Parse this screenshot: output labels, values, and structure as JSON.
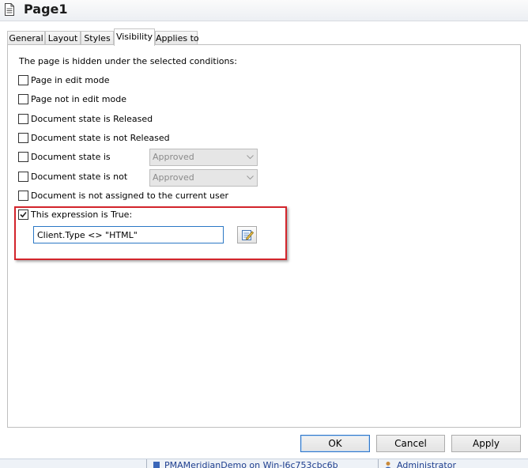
{
  "window": {
    "title": "Page1"
  },
  "tabs": [
    {
      "label": "General",
      "active": false
    },
    {
      "label": "Layout",
      "active": false
    },
    {
      "label": "Styles",
      "active": false
    },
    {
      "label": "Visibility",
      "active": true
    },
    {
      "label": "Applies to",
      "active": false
    }
  ],
  "visibility": {
    "intro": "The page is hidden under the selected conditions:",
    "options": [
      {
        "label": "Page in edit mode",
        "checked": false
      },
      {
        "label": "Page not in edit mode",
        "checked": false
      },
      {
        "label": "Document state is Released",
        "checked": false
      },
      {
        "label": "Document state is not Released",
        "checked": false
      },
      {
        "label": "Document state is",
        "checked": false,
        "select_value": "Approved",
        "select_disabled": true
      },
      {
        "label": "Document state is not",
        "checked": false,
        "select_value": "Approved",
        "select_disabled": true
      },
      {
        "label": "Document is not assigned to the current user",
        "checked": false
      },
      {
        "label": "This expression is True:",
        "checked": true
      }
    ],
    "expression": {
      "value": "Client.Type <> \"HTML\"",
      "edit_icon": "edit-expression-icon"
    },
    "highlight_color": "#d3252c"
  },
  "buttons": {
    "ok": "OK",
    "cancel": "Cancel",
    "apply": "Apply"
  },
  "statusbar": {
    "connection_icon": "database-icon",
    "connection": "PMAMeridianDemo on Win-I6c753cbc6b",
    "user_icon": "user-icon",
    "user": "Administrator"
  }
}
